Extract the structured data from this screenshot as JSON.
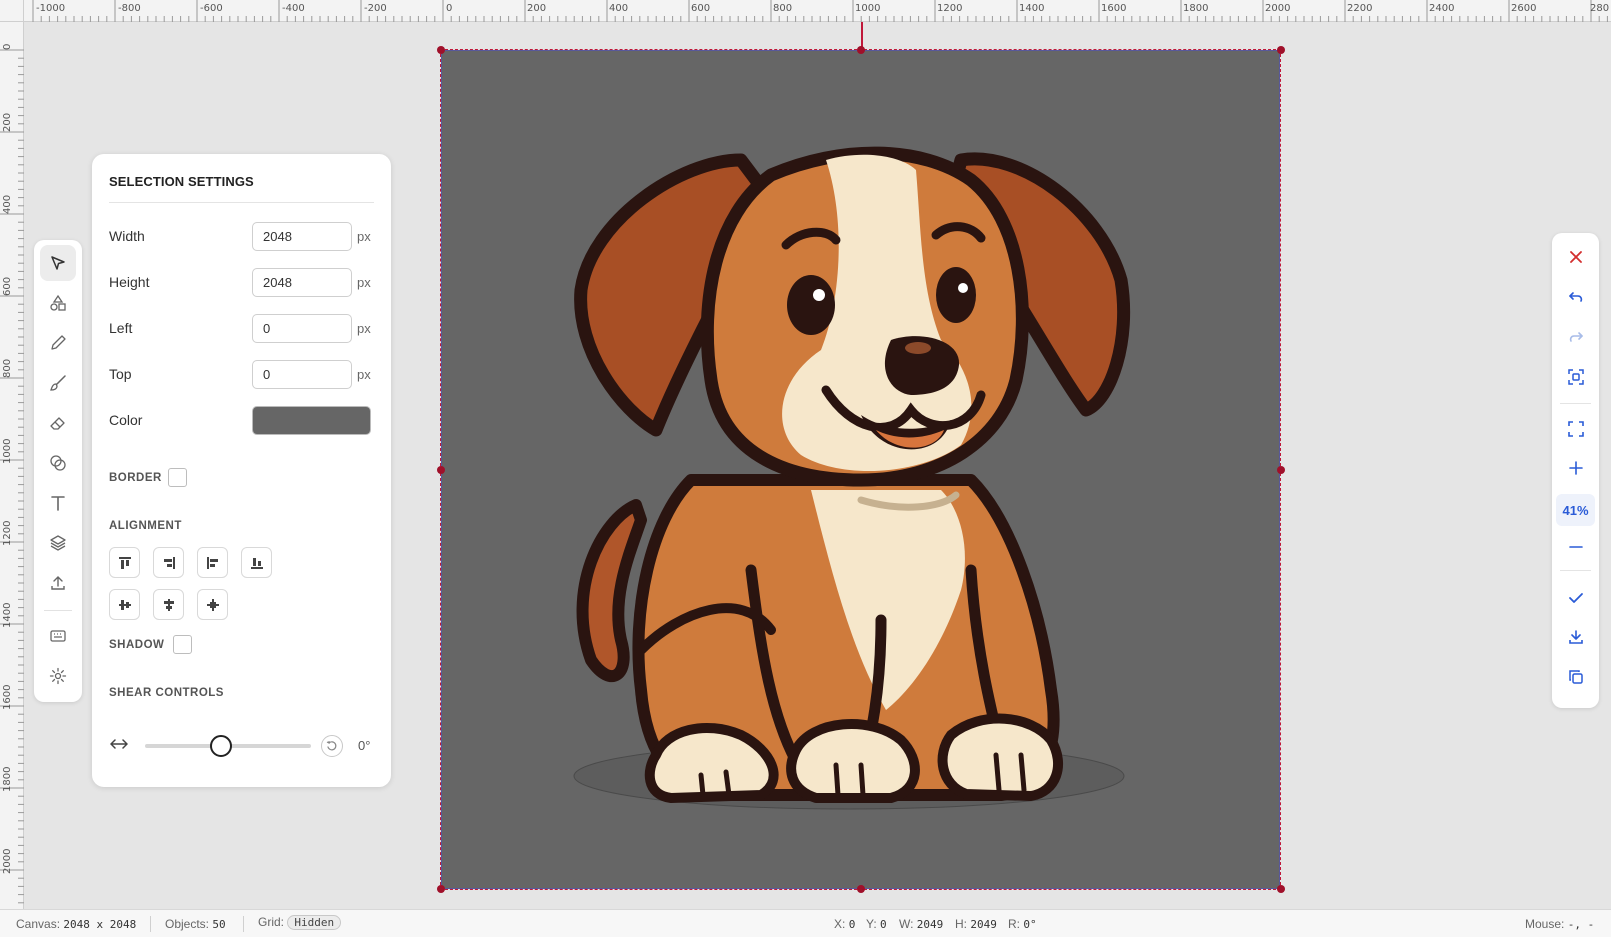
{
  "ruler": {
    "top_labels": [
      "-1000",
      "-800",
      "-600",
      "-400",
      "-200",
      "0",
      "200",
      "400",
      "600",
      "800",
      "1000",
      "1200",
      "1400",
      "1600",
      "1800",
      "2000",
      "2200",
      "2400",
      "2600",
      "280"
    ],
    "left_labels": [
      "0",
      "200",
      "400",
      "600",
      "800",
      "1000",
      "1200",
      "1400",
      "1600",
      "1800",
      "2000"
    ]
  },
  "canvas": {
    "background": "#666666",
    "image": "cartoon-puppy"
  },
  "panel": {
    "title": "SELECTION SETTINGS",
    "fields": [
      {
        "label": "Width",
        "value": "2048",
        "unit": "px"
      },
      {
        "label": "Height",
        "value": "2048",
        "unit": "px"
      },
      {
        "label": "Left",
        "value": "0",
        "unit": "px"
      },
      {
        "label": "Top",
        "value": "0",
        "unit": "px"
      }
    ],
    "color_label": "Color",
    "color_value": "#666666",
    "border_label": "BORDER",
    "alignment_label": "ALIGNMENT",
    "shadow_label": "SHADOW",
    "shear_label": "SHEAR CONTROLS",
    "shear_value": "0°",
    "shear_level": 0.5
  },
  "toolbar_left": [
    "select-tool",
    "shapes-tool",
    "pencil-tool",
    "brush-tool",
    "eraser-tool",
    "blend-tool",
    "text-tool",
    "layers-tool",
    "upload-tool",
    "keyboard-shortcuts",
    "settings"
  ],
  "toolbar_right": {
    "zoom": "41%",
    "accent": "#2a5bd7",
    "close_color": "#d32f2f"
  },
  "status": {
    "canvas_label": "Canvas:",
    "canvas_value": "2048 x 2048",
    "objects_label": "Objects:",
    "objects_value": "50",
    "grid_label": "Grid:",
    "grid_value": "Hidden",
    "x_label": "X:",
    "x_value": "0",
    "y_label": "Y:",
    "y_value": "0",
    "w_label": "W:",
    "w_value": "2049",
    "h_label": "H:",
    "h_value": "2049",
    "r_label": "R:",
    "r_value": "0°",
    "mouse_label": "Mouse:",
    "mouse_value": "-, -"
  }
}
